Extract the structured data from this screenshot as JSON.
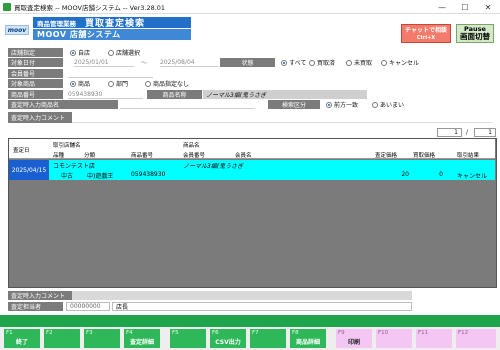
{
  "window": {
    "title": "買取査定検索 -- MOOV店舗システム -- Ver3.28.01",
    "minimize": "—",
    "maximize": "☐",
    "close": "✕"
  },
  "header": {
    "logo": "moov",
    "dept": "商品管理業務",
    "screen_title": "買取査定検索",
    "system_name": "MOOV 店舗システム",
    "chat_label": "チャットで相談",
    "chat_shortcut": "Ctrl+X",
    "pause_label": "Pause",
    "switch_label": "画面切替"
  },
  "form": {
    "store_label": "店舗指定",
    "store_opt_self": "自店",
    "store_opt_select": "店舗選択",
    "date_label": "対象日付",
    "date_from": "2025/01/01",
    "date_sep": "〜",
    "date_to": "2025/08/04",
    "status_label": "状態",
    "status_options": [
      "すべて",
      "買取済",
      "未買取",
      "キャンセル"
    ],
    "member_label": "会員番号",
    "target_label": "対象商品",
    "target_options": [
      "商品",
      "部門",
      "商品指定なし"
    ],
    "product_no_label": "商品番号",
    "product_no_value": "059438930",
    "product_name_label": "商品名称",
    "product_name_value": "ノーマル3編(鬼うさぎ",
    "input_product_label": "査定時入力商品名",
    "search_type_label": "検索区分",
    "search_type_options": [
      "前方一致",
      "あいまい"
    ],
    "comment_label": "査定時入力コメント"
  },
  "pager": {
    "current": "1",
    "sep": "/",
    "total": "1"
  },
  "grid": {
    "headers": {
      "date": "査定日",
      "store": "取引店舗名",
      "product_name": "商品名",
      "item": "品種",
      "category": "分類",
      "product_no": "商品番号",
      "member_no": "会員番号",
      "member_name": "会員名",
      "price": "査定価格",
      "qty": "買取価格",
      "result": "取引結果"
    },
    "rows": [
      {
        "date": "2025/04/15",
        "store": "コモンテスト店",
        "product_name": "ノーマル3編(鬼うさぎ",
        "item": "中古",
        "category": "中)遊戯王",
        "product_no": "059438930",
        "price": "20",
        "qty": "0",
        "result": "キャンセル"
      }
    ]
  },
  "bottom": {
    "comment_label": "査定時入力コメント",
    "assessor_label": "査定担当者",
    "assessor_code": "00000000",
    "assessor_name": "店長"
  },
  "fkeys": [
    {
      "key": "F1",
      "label": "終了"
    },
    {
      "key": "F2",
      "label": ""
    },
    {
      "key": "F3",
      "label": ""
    },
    {
      "key": "F4",
      "label": "査定詳細"
    },
    {
      "key": "F5",
      "label": ""
    },
    {
      "key": "F6",
      "label": "CSV出力"
    },
    {
      "key": "F7",
      "label": ""
    },
    {
      "key": "F8",
      "label": "商品詳細"
    },
    {
      "key": "F9",
      "label": "印刷"
    },
    {
      "key": "F10",
      "label": ""
    },
    {
      "key": "F11",
      "label": ""
    },
    {
      "key": "F12",
      "label": ""
    }
  ],
  "colors": {
    "accent": "#2270c7",
    "selected_row": "#00ffff",
    "fkey_green": "#2eb85a",
    "fkey_pink": "#f3c6f3",
    "footer": "#1ea44b"
  }
}
